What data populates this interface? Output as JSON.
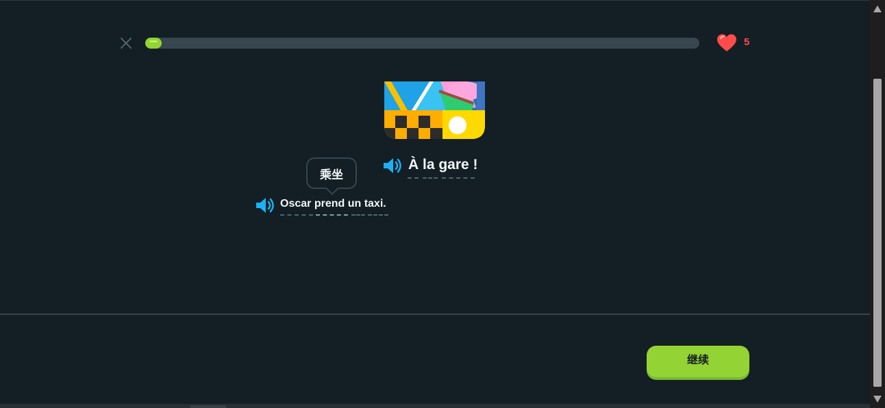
{
  "header": {
    "close_icon": "close-icon",
    "progress_fraction": 0.03,
    "hearts": {
      "icon": "heart-icon",
      "count": "5"
    }
  },
  "main": {
    "illustration": "taxi-scene-image",
    "title": {
      "speaker_icon": "speaker-icon",
      "text": "À la gare !"
    },
    "hint_tooltip": {
      "text": "乘坐"
    },
    "sentence": {
      "speaker_icon": "speaker-icon",
      "text": "Oscar prend un taxi."
    }
  },
  "footer": {
    "continue_label": "继续"
  },
  "colors": {
    "background": "#131f24",
    "accent_green": "#93d333",
    "progress_track": "#37464f",
    "heart_red": "#ff4b4b",
    "speaker_blue": "#1cb0f6"
  }
}
